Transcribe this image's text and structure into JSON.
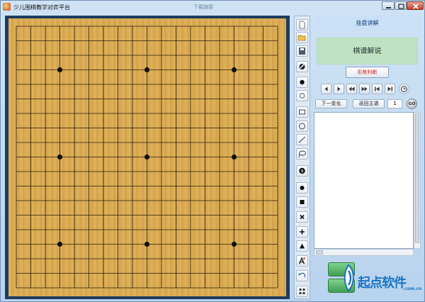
{
  "window": {
    "title": "少儿围棋教学对弈平台",
    "center_label": "下载链接"
  },
  "board": {
    "size": 19,
    "star_points": 9
  },
  "toolbar": {
    "items": [
      "new-file",
      "open-folder",
      "save",
      "eraser",
      "black-stone",
      "white-stone",
      "rectangle",
      "ellipse",
      "line",
      "lasso",
      "number-stone",
      "dot-mark",
      "square-mark",
      "x-mark",
      "plus-mark",
      "triangle-mark",
      "text-label",
      "undo",
      "grid"
    ]
  },
  "panel": {
    "header": "挂盘讲解",
    "section_title": "棋谱解说",
    "judge_button": "形势判断",
    "next_variation": "下一变化",
    "back_to_main": "返回主谱",
    "move_number": "1",
    "go_label": "GO"
  },
  "watermark": {
    "text": "起点软件",
    "sub": ".com.cn"
  },
  "colors": {
    "board": "#dcae56",
    "frame": "#1e3c60",
    "accent": "#1a74c2",
    "judge_text": "#d21c1c"
  }
}
